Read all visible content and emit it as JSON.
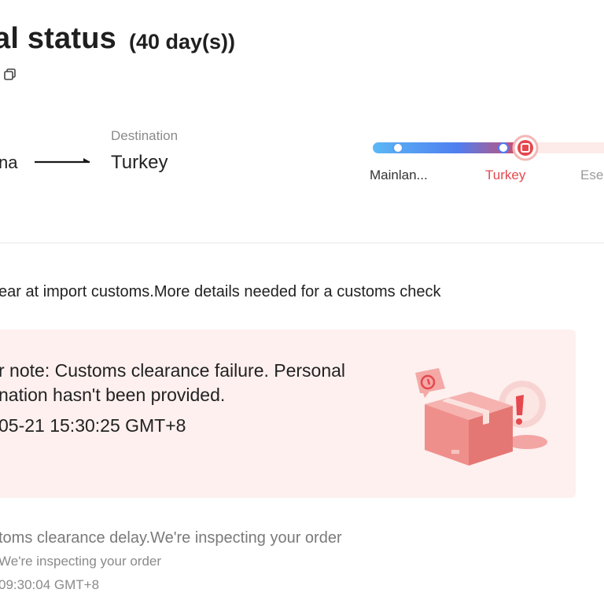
{
  "header": {
    "title": "al status",
    "days": "(40 day(s))",
    "copy_icon": "copy-icon"
  },
  "route": {
    "origin": "na",
    "destination_label": "Destination",
    "destination_value": "Turkey"
  },
  "tracker": {
    "steps": [
      {
        "label": "Mainlan...",
        "status": "done"
      },
      {
        "label": "Turkey",
        "status": "current"
      },
      {
        "label": "Esen",
        "status": "pending"
      }
    ],
    "colors": {
      "start": "#56b4f4",
      "mid": "#4f7cf0",
      "current": "#e5484d",
      "pending": "#fbe9e7"
    }
  },
  "status": {
    "line": "ear at import customs.More details needed for a customs check"
  },
  "alert": {
    "note": "r note: Customs clearance failure. Personal\nnation hasn't been provided.",
    "time": "05-21 15:30:25 GMT+8",
    "background": "#fdf0ef",
    "illustration": "customs-box-alert-illustration"
  },
  "events": [
    {
      "title": "toms clearance delay.We're inspecting your order",
      "subtitle": "We're inspecting your order",
      "time": "09:30:04 GMT+8"
    }
  ]
}
